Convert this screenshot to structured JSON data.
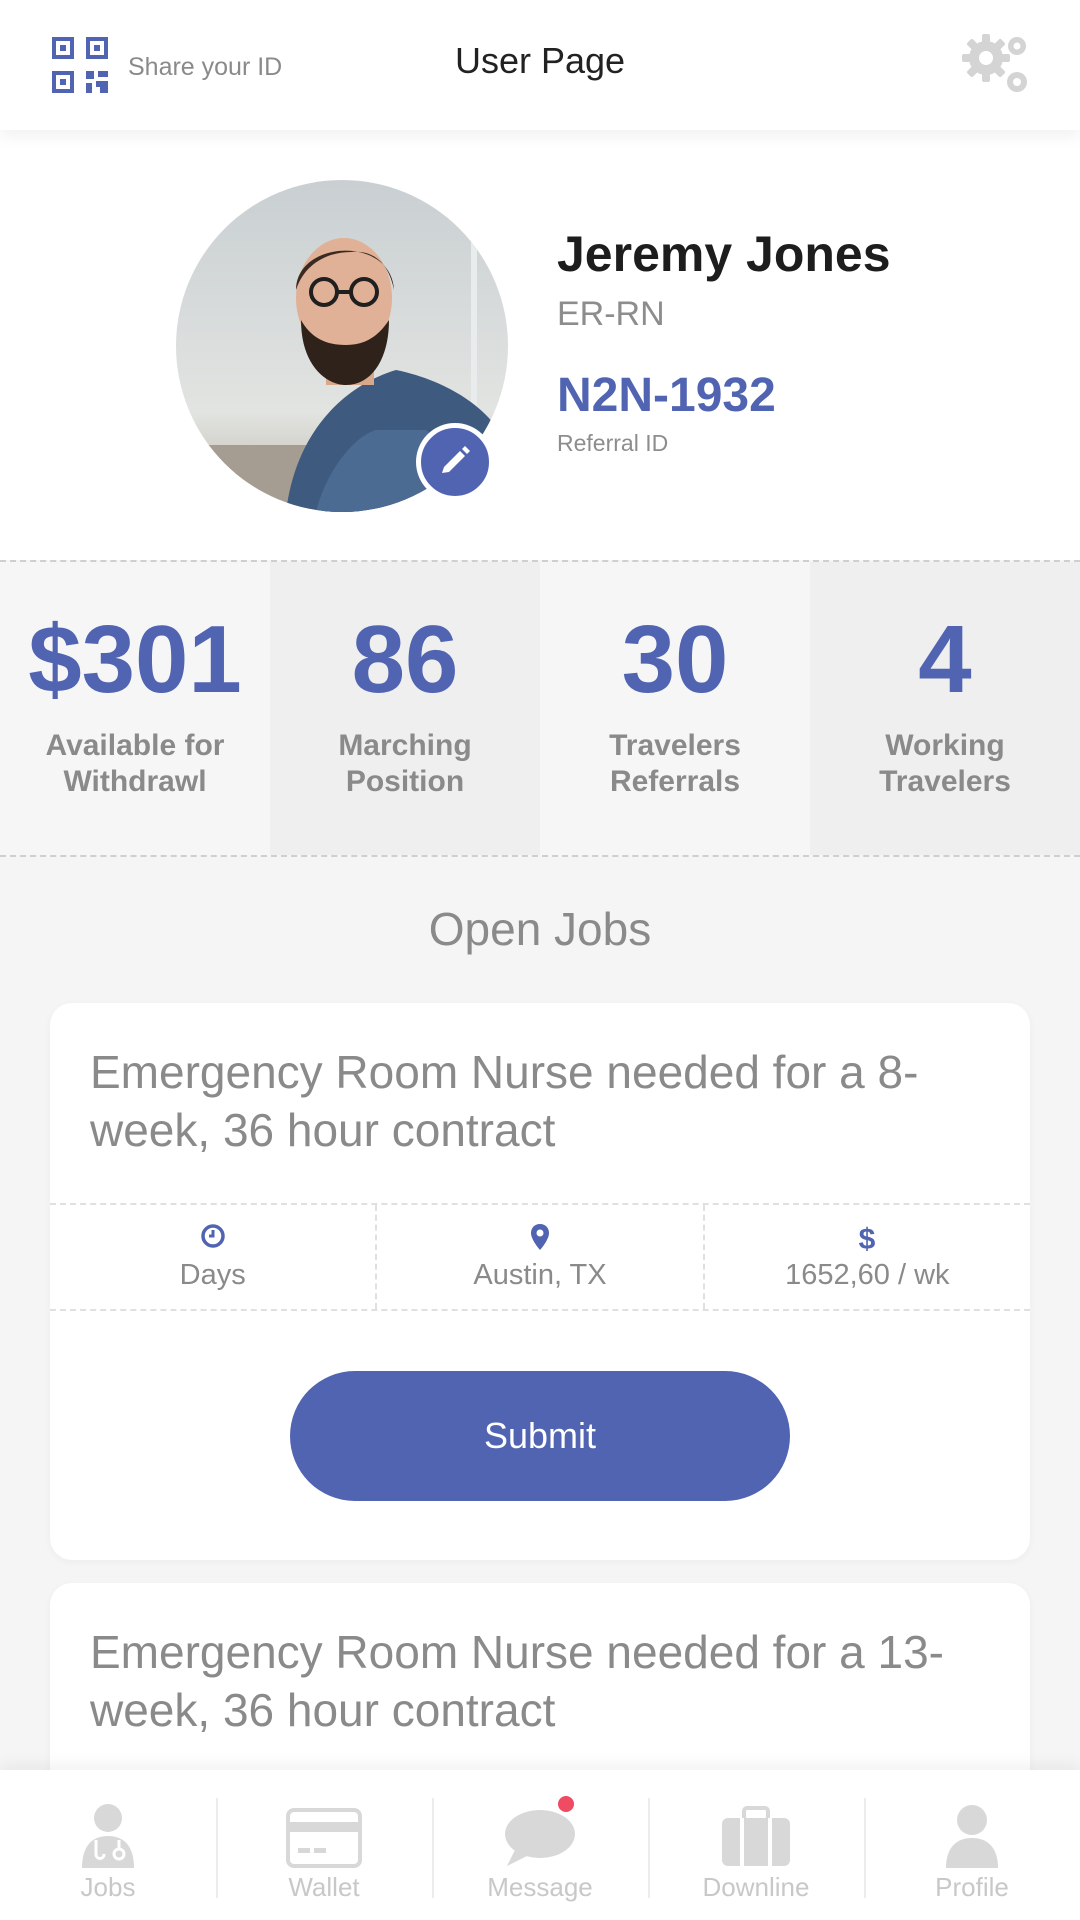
{
  "header": {
    "share_label": "Share your ID",
    "title": "User Page"
  },
  "profile": {
    "name": "Jeremy Jones",
    "role": "ER-RN",
    "referral_id": "N2N-1932",
    "referral_label": "Referral ID"
  },
  "stats": [
    {
      "value": "$301",
      "label_line1": "Available for",
      "label_line2": "Withdrawl"
    },
    {
      "value": "86",
      "label_line1": "Marching",
      "label_line2": "Position"
    },
    {
      "value": "30",
      "label_line1": "Travelers",
      "label_line2": "Referrals"
    },
    {
      "value": "4",
      "label_line1": "Working",
      "label_line2": "Travelers"
    }
  ],
  "open_jobs": {
    "title": "Open Jobs",
    "jobs": [
      {
        "title": "Emergency Room Nurse needed for a 8-week, 36 hour contract",
        "schedule": "Days",
        "location": "Austin, TX",
        "pay": "1652,60 / wk",
        "submit_label": "Submit"
      },
      {
        "title": "Emergency Room Nurse needed for a 13-week, 36 hour contract"
      }
    ]
  },
  "bottom_nav": [
    {
      "label": "Jobs",
      "icon": "doctor-icon"
    },
    {
      "label": "Wallet",
      "icon": "wallet-card-icon"
    },
    {
      "label": "Message",
      "icon": "chat-bubble-icon"
    },
    {
      "label": "Downline",
      "icon": "briefcase-icon"
    },
    {
      "label": "Profile",
      "icon": "user-icon"
    }
  ],
  "colors": {
    "accent": "#5164b2",
    "badge": "#ef4b63",
    "muted_text": "#8a8a8a"
  }
}
